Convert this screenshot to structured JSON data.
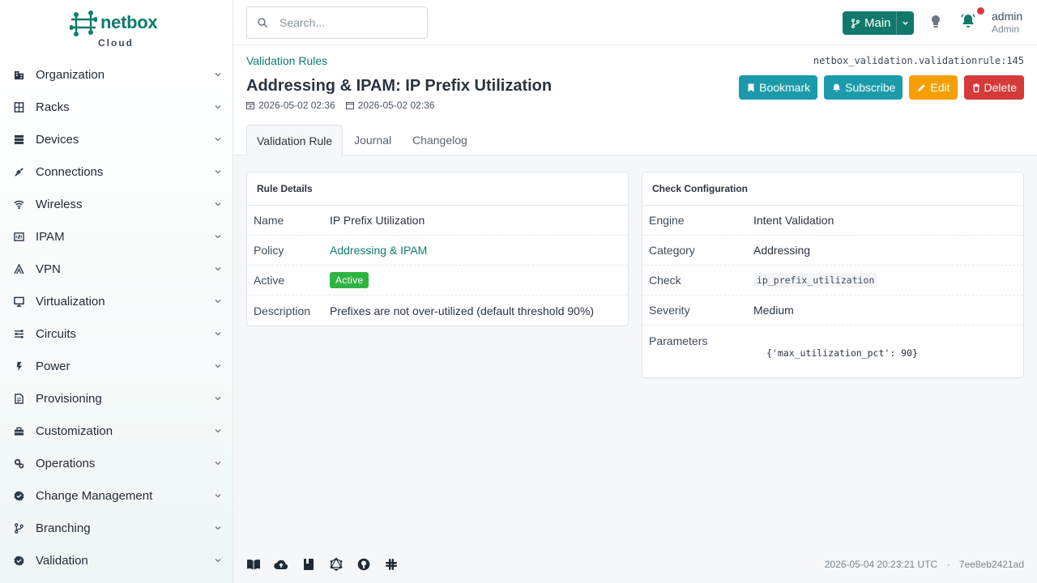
{
  "brand": {
    "name": "netbox",
    "sub": "Cloud"
  },
  "sidebar": {
    "items": [
      {
        "label": "Organization",
        "icon": "building-icon"
      },
      {
        "label": "Racks",
        "icon": "rack-icon"
      },
      {
        "label": "Devices",
        "icon": "server-icon"
      },
      {
        "label": "Connections",
        "icon": "plug-icon"
      },
      {
        "label": "Wireless",
        "icon": "wifi-icon"
      },
      {
        "label": "IPAM",
        "icon": "counter-icon"
      },
      {
        "label": "VPN",
        "icon": "tunnel-icon"
      },
      {
        "label": "Virtualization",
        "icon": "monitor-icon"
      },
      {
        "label": "Circuits",
        "icon": "transit-icon"
      },
      {
        "label": "Power",
        "icon": "flash-icon"
      },
      {
        "label": "Provisioning",
        "icon": "file-document-icon"
      },
      {
        "label": "Customization",
        "icon": "toolbox-icon"
      },
      {
        "label": "Operations",
        "icon": "cogs-icon"
      },
      {
        "label": "Change Management",
        "icon": "check-decagram-icon"
      },
      {
        "label": "Branching",
        "icon": "source-branch-icon"
      },
      {
        "label": "Validation",
        "icon": "check-decagram-icon"
      }
    ]
  },
  "header": {
    "search_placeholder": "Search...",
    "branch_label": "Main",
    "user_name": "admin",
    "user_role": "Admin"
  },
  "page": {
    "breadcrumb": "Validation Rules",
    "object_id": "netbox_validation.validationrule:145",
    "title": "Addressing & IPAM: IP Prefix Utilization",
    "created": "2026-05-02 02:36",
    "updated": "2026-05-02 02:36",
    "actions": {
      "bookmark": "Bookmark",
      "subscribe": "Subscribe",
      "edit": "Edit",
      "delete": "Delete"
    },
    "tabs": [
      {
        "label": "Validation Rule",
        "active": true
      },
      {
        "label": "Journal",
        "active": false
      },
      {
        "label": "Changelog",
        "active": false
      }
    ]
  },
  "rule_details": {
    "heading": "Rule Details",
    "rows": [
      {
        "key": "Name",
        "value": "IP Prefix Utilization"
      },
      {
        "key": "Policy",
        "value": "Addressing & IPAM"
      },
      {
        "key": "Active",
        "value": "Active"
      },
      {
        "key": "Description",
        "value": "Prefixes are not over-utilized (default threshold 90%)"
      }
    ]
  },
  "check_config": {
    "heading": "Check Configuration",
    "rows": [
      {
        "key": "Engine",
        "value": "Intent Validation"
      },
      {
        "key": "Category",
        "value": "Addressing"
      },
      {
        "key": "Check",
        "value": "ip_prefix_utilization"
      },
      {
        "key": "Severity",
        "value": "Medium"
      },
      {
        "key": "Parameters",
        "value": "{'max_utilization_pct': 90}"
      }
    ]
  },
  "footer": {
    "timestamp": "2026-05-04 20:23:21 UTC",
    "separator": "·",
    "commit": "7ee8eb2421ad"
  },
  "colors": {
    "brand": "#11796b",
    "cyan": "#1b9aaa",
    "orange": "#f59f00",
    "red": "#d63939",
    "success": "#2fb344"
  }
}
